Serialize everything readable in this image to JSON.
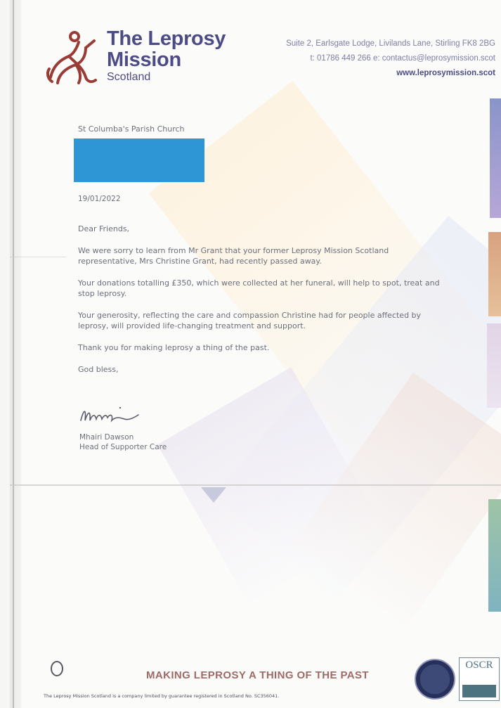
{
  "header": {
    "org_line1": "The Leprosy",
    "org_line2": "Mission",
    "org_line3": "Scotland",
    "address": "Suite 2, Earlsgate Lodge, Livilands Lane, Stirling FK8 2BG",
    "contact": "t: 01786 449 266    e: contactus@leprosymission.scot",
    "website": "www.leprosymission.scot"
  },
  "letter": {
    "recipient": "St Columba's Parish Church",
    "date": "19/01/2022",
    "salutation": "Dear Friends,",
    "paragraphs": [
      "We were sorry to learn from Mr Grant that your former Leprosy Mission Scotland representative, Mrs Christine Grant, had recently passed away.",
      "Your donations totalling £350, which were collected at her funeral, will help to spot, treat and stop leprosy.",
      "Your generosity, reflecting the care and compassion Christine had for people affected by leprosy, will provided life-changing treatment and support.",
      "Thank you for making leprosy a thing of the past.",
      "God bless,"
    ],
    "signer_name": "Mhairi Dawson",
    "signer_title": "Head of Supporter Care"
  },
  "footer": {
    "tagline": "MAKING LEPROSY A THING OF THE PAST",
    "oscr": "OSCR",
    "legal": "The Leprosy Mission Scotland is a company limited by guarantee registered in Scotland No. SC356041."
  },
  "colors": {
    "brand": "#4c4b86",
    "logo": "#9a3b36",
    "redaction": "#2f96d5",
    "tagline": "#9e6a66"
  }
}
